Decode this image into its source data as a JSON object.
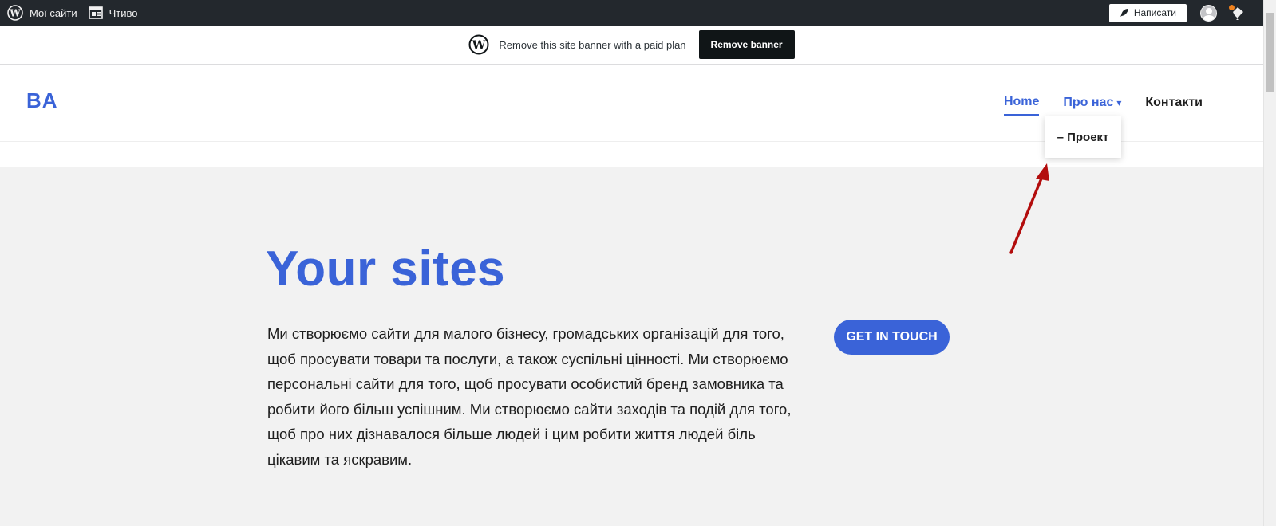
{
  "adminbar": {
    "my_sites_label": "Мої сайти",
    "reader_label": "Чтиво",
    "write_label": "Написати",
    "icons": {
      "my_sites": "wordpress-logo-icon",
      "reader": "reader-icon",
      "write": "feather-pen-icon",
      "avatar": "user-avatar-icon",
      "notifications": "bell-notifications-icon"
    },
    "notification_color": "#f0821e"
  },
  "banner": {
    "text": "Remove this site banner with a paid plan",
    "button_label": "Remove banner",
    "icon": "wordpress-logo-icon"
  },
  "site": {
    "title": "BA",
    "accent_color": "#3a63d8"
  },
  "nav": {
    "items": [
      {
        "label": "Home",
        "active": true
      },
      {
        "label": "Про нас",
        "caret": "▾",
        "has_submenu": true
      },
      {
        "label": "Контакти"
      }
    ],
    "submenu_items": [
      {
        "label": "– Проект"
      }
    ]
  },
  "hero": {
    "title": "Your sites",
    "text": "Ми створюємо сайти для малого бізнесу, громадських організацій для того, щоб просувати товари та послуги, а також суспільні цінності. Ми створюємо персональні сайти для того, щоб просувати особистий бренд замовника та робити його більш успішним. Ми створюємо сайти заходів та подій для того, щоб про них дізнавалося більше людей і цим робити життя людей біль цікавим та яскравим.",
    "cta_label": "GET IN TOUCH",
    "background": "#f2f2f2"
  },
  "annotation": {
    "icon": "red-arrow-annotation-icon",
    "color": "#b30d0d"
  }
}
